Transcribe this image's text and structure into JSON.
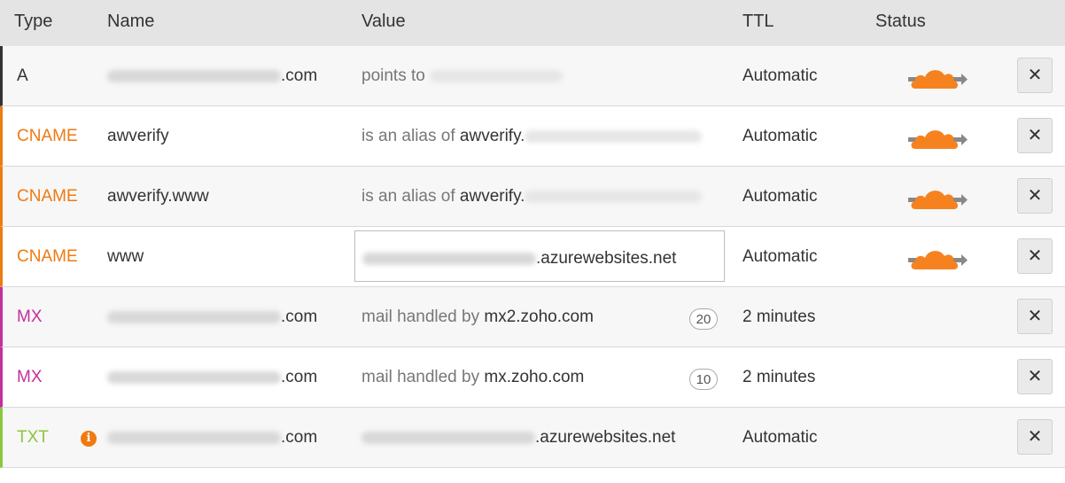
{
  "columns": {
    "type": "Type",
    "name": "Name",
    "value": "Value",
    "ttl": "TTL",
    "status": "Status"
  },
  "colors": {
    "A": "#333333",
    "CNAME": "#f07a12",
    "MX": "#c3309a",
    "TXT": "#8cc63f",
    "cloud_orange": "#f6821f",
    "cloud_gray": "#888888"
  },
  "rows": [
    {
      "type": "A",
      "name_suffix": ".com",
      "value_prefix": "points to",
      "value_main": "",
      "ttl": "Automatic",
      "proxied": true
    },
    {
      "type": "CNAME",
      "name": "awverify",
      "value_prefix": "is an alias of",
      "value_main": "awverify.",
      "ttl": "Automatic",
      "proxied": true
    },
    {
      "type": "CNAME",
      "name": "awverify.www",
      "value_prefix": "is an alias of",
      "value_main": "awverify.",
      "ttl": "Automatic",
      "proxied": true
    },
    {
      "type": "CNAME",
      "name": "www",
      "value_main": ".azurewebsites.net",
      "ttl": "Automatic",
      "proxied": true
    },
    {
      "type": "MX",
      "name_suffix": ".com",
      "value_prefix": "mail handled by",
      "value_main": "mx2.zoho.com",
      "priority": "20",
      "ttl": "2 minutes",
      "proxied": false
    },
    {
      "type": "MX",
      "name_suffix": ".com",
      "value_prefix": "mail handled by",
      "value_main": "mx.zoho.com",
      "priority": "10",
      "ttl": "2 minutes",
      "proxied": false
    },
    {
      "type": "TXT",
      "name_suffix": ".com",
      "value_main": ".azurewebsites.net",
      "ttl": "Automatic",
      "proxied": false
    }
  ],
  "icons": {
    "delete": "close-icon",
    "status": "cloud-icon",
    "info": "info-icon"
  },
  "delete_glyph": "✕",
  "info_glyph": "i"
}
